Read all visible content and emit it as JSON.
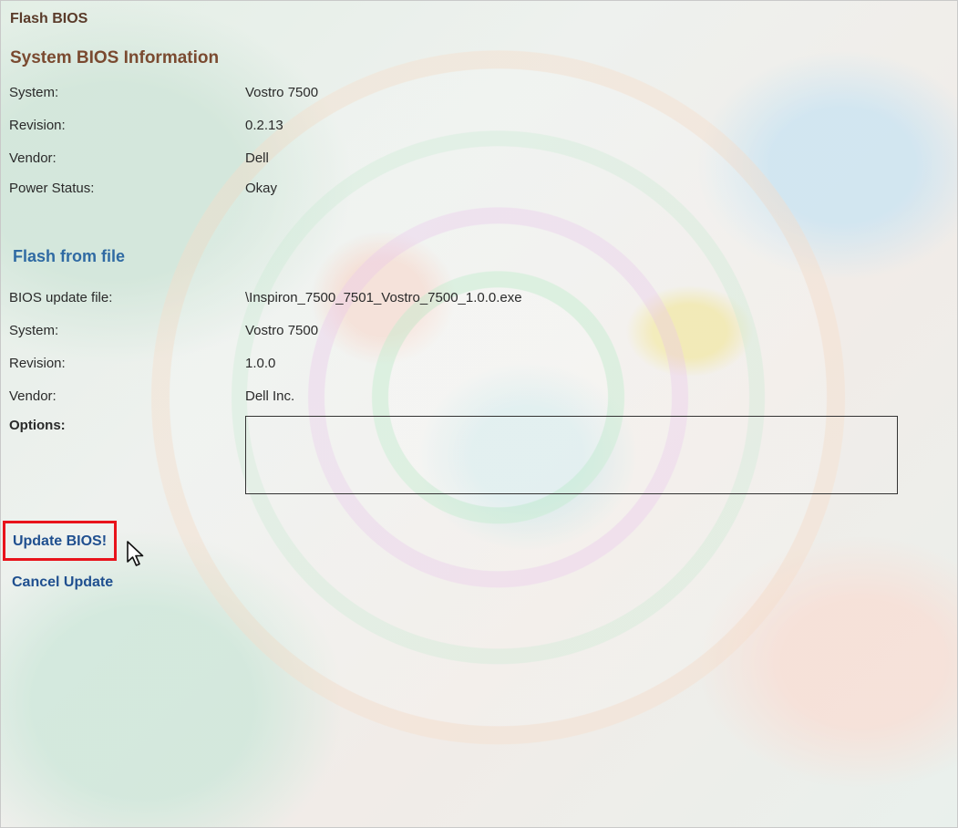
{
  "window": {
    "title": "Flash BIOS"
  },
  "system_info": {
    "heading": "System BIOS Information",
    "rows": [
      {
        "label": "System:",
        "value": "Vostro 7500"
      },
      {
        "label": "Revision:",
        "value": "0.2.13"
      },
      {
        "label": "Vendor:",
        "value": "Dell"
      },
      {
        "label": "Power Status:",
        "value": "Okay"
      }
    ]
  },
  "flash_file": {
    "heading": "Flash from file",
    "rows": [
      {
        "label": "BIOS update file:",
        "value": "\\Inspiron_7500_7501_Vostro_7500_1.0.0.exe"
      },
      {
        "label": "System:",
        "value": "Vostro 7500"
      },
      {
        "label": "Revision:",
        "value": "1.0.0"
      },
      {
        "label": "Vendor:",
        "value": "Dell Inc."
      }
    ],
    "options_label": "Options:",
    "options_value": ""
  },
  "actions": {
    "update": "Update BIOS!",
    "cancel": "Cancel Update"
  },
  "theme": {
    "title_color": "#5a3b2a",
    "section_heading_color": "#7a4a30",
    "link_color": "#1f4f8f",
    "highlight_border": "#e8131b"
  },
  "icons": {
    "pointer": "mouse-pointer-icon"
  }
}
